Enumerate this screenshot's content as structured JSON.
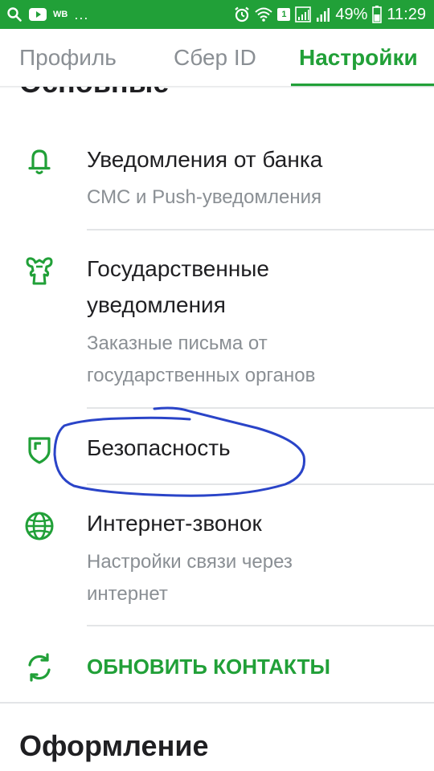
{
  "status_bar": {
    "left_label": "WB",
    "more": "...",
    "sim_badge": "1",
    "battery": "49%",
    "time": "11:29",
    "icons": [
      "search-icon",
      "youtube-icon",
      "alarm-icon",
      "wifi-icon",
      "signal-icon",
      "battery-icon"
    ]
  },
  "tabs": [
    {
      "label": "Профиль",
      "active": false
    },
    {
      "label": "Сбер ID",
      "active": false
    },
    {
      "label": "Настройки",
      "active": true
    }
  ],
  "sections": {
    "main_heading": "Основные",
    "design_heading": "Оформление"
  },
  "items": [
    {
      "icon": "bell-icon",
      "title": "Уведомления от банка",
      "subtitle_lines": [
        "СМС и Push-уведомления"
      ]
    },
    {
      "icon": "state-emblem-icon",
      "title_lines": [
        "Государственные",
        "уведомления"
      ],
      "subtitle_lines": [
        "Заказные письма от",
        "государственных органов"
      ]
    },
    {
      "icon": "shield-icon",
      "title": "Безопасность"
    },
    {
      "icon": "globe-icon",
      "title": "Интернет-звонок",
      "subtitle_lines": [
        "Настройки связи через",
        "интернет"
      ]
    }
  ],
  "action": {
    "icon": "refresh-icon",
    "label": "ОБНОВИТЬ КОНТАКТЫ"
  },
  "colors": {
    "brand_green": "#21a038",
    "text_primary": "#1f1f22",
    "text_secondary": "#8a8f94",
    "divider": "#e3e5e7",
    "annotation_blue": "#2a44c8"
  }
}
